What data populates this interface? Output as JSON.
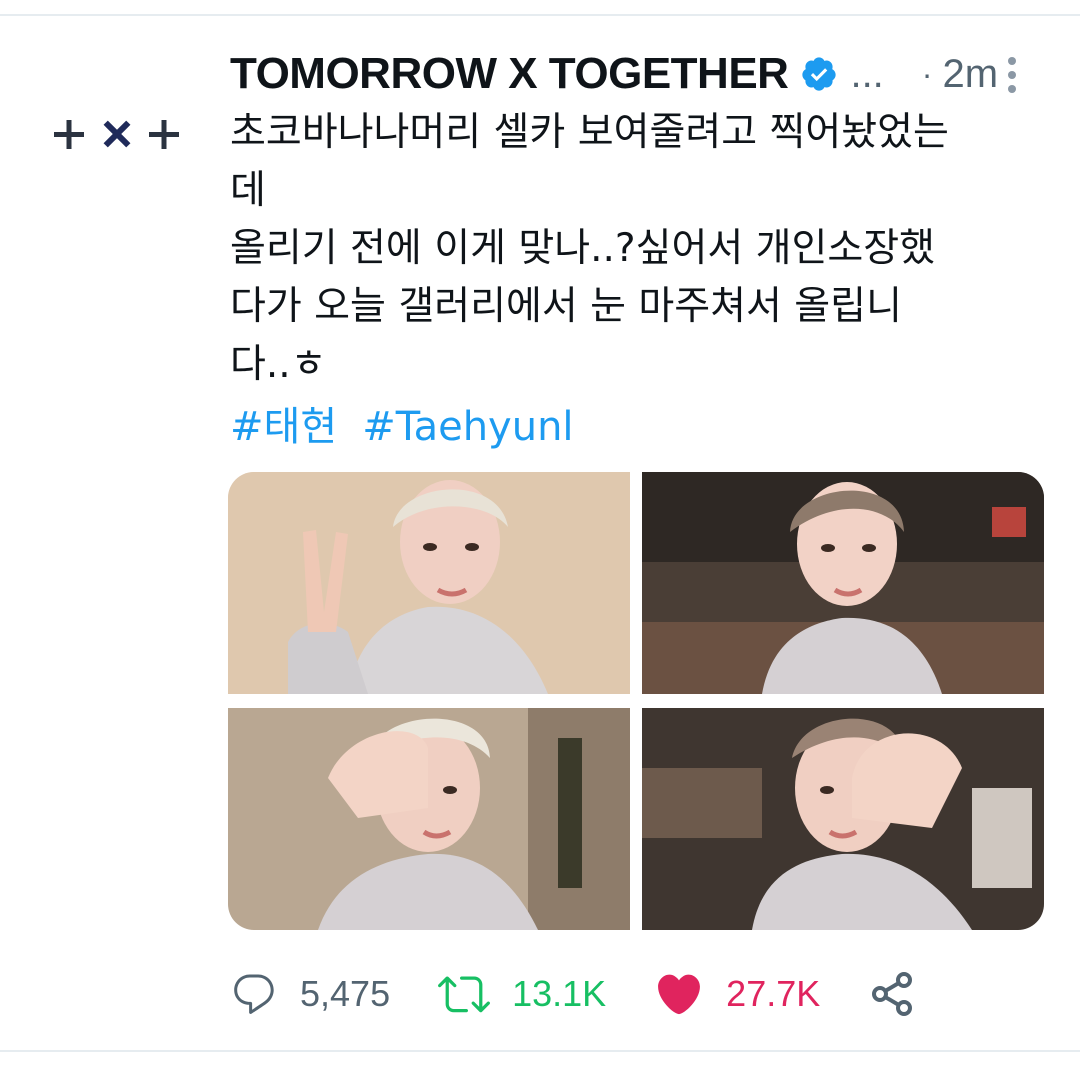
{
  "tweet": {
    "display_name": "TOMORROW X TOGETHER",
    "handle": "...",
    "separator": "·",
    "time": "2m",
    "avatar_logo": "+×+",
    "text_lines": [
      "초코바나나머리 셀카 보여줄려고 찍어놨었는",
      "데",
      "올리기 전에 이게 맞나..?싶어서 개인소장했",
      "다가 오늘 갤러리에서 눈 마주쳐서 올립니",
      "다..ㅎ"
    ],
    "hashtags": [
      "#태현",
      "#Taehyunl"
    ],
    "media": [
      {
        "icon": "photo-selfie-peace-sign"
      },
      {
        "icon": "photo-selfie-room"
      },
      {
        "icon": "photo-selfie-hand-over-eye"
      },
      {
        "icon": "photo-selfie-hand-over-eye-2"
      }
    ]
  },
  "actions": {
    "reply": {
      "icon": "reply-icon",
      "count": "5,475"
    },
    "retweet": {
      "icon": "retweet-icon",
      "count": "13.1K",
      "color": "#17bf63"
    },
    "like": {
      "icon": "heart-icon",
      "count": "27.7K",
      "color": "#e0245e"
    },
    "share": {
      "icon": "share-icon"
    }
  },
  "colors": {
    "link": "#1d9bf0",
    "verified": "#1d9bf0",
    "secondary_text": "#536471"
  }
}
